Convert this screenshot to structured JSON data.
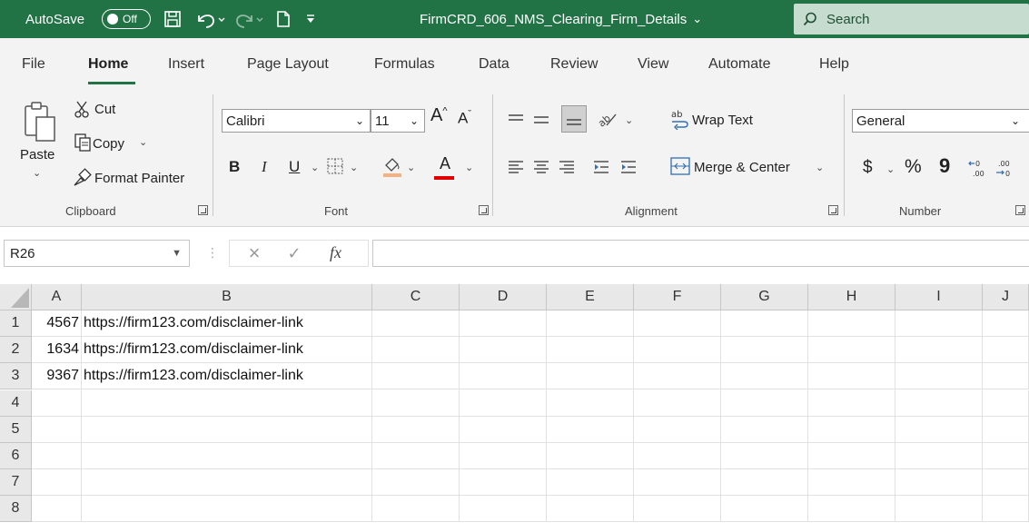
{
  "titlebar": {
    "autosave_label": "AutoSave",
    "autosave_state": "Off",
    "doc_title": "FirmCRD_606_NMS_Clearing_Firm_Details",
    "search_label": "Search",
    "accent": "#217346"
  },
  "tabs": [
    "File",
    "Home",
    "Insert",
    "Page Layout",
    "Formulas",
    "Data",
    "Review",
    "View",
    "Automate",
    "Help"
  ],
  "active_tab": "Home",
  "ribbon": {
    "clipboard": {
      "label": "Clipboard",
      "paste": "Paste",
      "cut": "Cut",
      "copy": "Copy",
      "format_painter": "Format Painter"
    },
    "font": {
      "label": "Font",
      "font_name": "Calibri",
      "font_size": "11",
      "bold": "B",
      "italic": "I",
      "underline": "U",
      "grow": "A",
      "shrink": "A",
      "font_color": "A",
      "highlight_color": "#f4b183",
      "font_color_hex": "#e00000"
    },
    "alignment": {
      "label": "Alignment",
      "wrap_text": "Wrap Text",
      "merge_center": "Merge & Center"
    },
    "number": {
      "label": "Number",
      "format": "General",
      "currency": "$",
      "percent": "%",
      "comma": "9"
    }
  },
  "formula_bar": {
    "name_box": "R26",
    "fx": "fx",
    "value": ""
  },
  "sheet": {
    "columns": [
      "A",
      "B",
      "C",
      "D",
      "E",
      "F",
      "G",
      "H",
      "I",
      "J"
    ],
    "rows": [
      "1",
      "2",
      "3",
      "4",
      "5",
      "6",
      "7",
      "8"
    ],
    "data": [
      [
        "4567",
        "https://firm123.com/disclaimer-link"
      ],
      [
        "1634",
        "https://firm123.com/disclaimer-link"
      ],
      [
        "9367",
        "https://firm123.com/disclaimer-link"
      ]
    ]
  }
}
